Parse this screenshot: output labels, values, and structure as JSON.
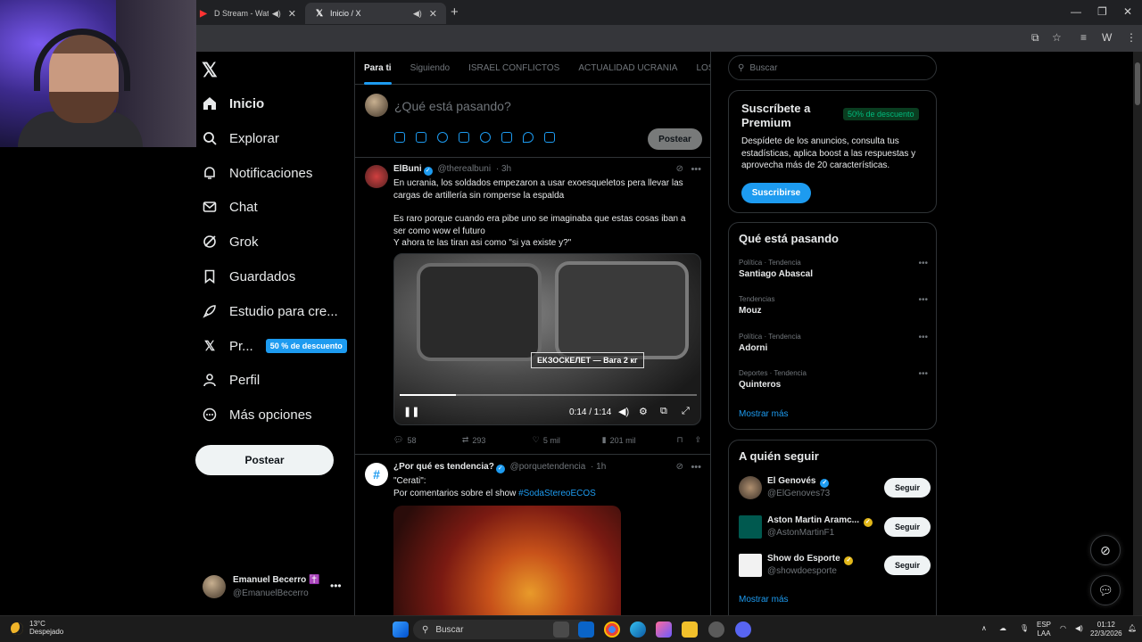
{
  "browser": {
    "tabs": [
      {
        "title": "D Stream - Watch Live o",
        "favicon": "youtube-icon",
        "active": false
      },
      {
        "title": "Inicio / X",
        "favicon": "x-logo-icon",
        "active": true
      }
    ]
  },
  "sidebar": {
    "items": [
      {
        "label": "Inicio",
        "icon": "home-icon",
        "active": true
      },
      {
        "label": "Explorar",
        "icon": "search-icon"
      },
      {
        "label": "Notificaciones",
        "icon": "bell-icon"
      },
      {
        "label": "Chat",
        "icon": "mail-icon"
      },
      {
        "label": "Grok",
        "icon": "grok-icon"
      },
      {
        "label": "Guardados",
        "icon": "bookmark-icon"
      },
      {
        "label": "Estudio para cre...",
        "icon": "rocket-icon"
      },
      {
        "label": "Pr...",
        "icon": "x-logo-icon",
        "badge": "50 % de descuento"
      },
      {
        "label": "Perfil",
        "icon": "person-icon"
      },
      {
        "label": "Más opciones",
        "icon": "more-circle-icon"
      }
    ],
    "post_button": "Postear",
    "profile": {
      "name": "Emanuel Becerro ✝️",
      "handle": "@EmanuelBecerro"
    }
  },
  "feed": {
    "tabs": [
      "Para ti",
      "Siguiendo",
      "ISRAEL CONFLICTOS",
      "ACTUALIDAD UCRANIA",
      "LOS"
    ],
    "compose": {
      "placeholder": "¿Qué está pasando?",
      "post_button": "Postear"
    },
    "tweets": [
      {
        "name": "ElBuni",
        "handle": "@therealbuni",
        "time": "· 3h",
        "paragraphs": [
          "En ucrania, los soldados empezaron a usar exoesqueletos pera llevar las cargas de artillería sin romperse la espalda",
          "Es raro porque cuando era pibe uno se imaginaba que estas cosas iban a ser como wow el futuro\nY ahora te las tiran asi como \"si ya existe y?\""
        ],
        "video": {
          "overlay_text": "ЕКЗОСКЕЛЕТ — Вага 2 кг",
          "time": "0:14 / 1:14",
          "progress": 0.19
        },
        "actions": {
          "replies": "58",
          "reposts": "293",
          "likes": "5 mil",
          "views": "201 mil"
        }
      },
      {
        "name": "¿Por qué es tendencia?",
        "handle": "@porquetendencia",
        "time": "· 1h",
        "paragraphs": [
          "\"Cerati\":\nPor comentarios sobre el show "
        ],
        "hashtag": "#SodaStereoECOS"
      }
    ]
  },
  "right": {
    "search_placeholder": "Buscar",
    "premium": {
      "title": "Suscríbete a Premium",
      "discount": "50% de descuento",
      "description": "Despídete de los anuncios, consulta tus estadísticas, aplica boost a las respuestas y aprovecha más de 20 características.",
      "button": "Suscribirse"
    },
    "trends": {
      "title": "Qué está pasando",
      "items": [
        {
          "context": "Política · Tendencia",
          "name": "Santiago Abascal"
        },
        {
          "context": "Tendencias",
          "name": "Mouz"
        },
        {
          "context": "Política · Tendencia",
          "name": "Adorni"
        },
        {
          "context": "Deportes · Tendencia",
          "name": "Quinteros"
        }
      ],
      "more": "Mostrar más"
    },
    "who_to_follow": {
      "title": "A quién seguir",
      "users": [
        {
          "name": "El Genovés",
          "handle": "@ElGenoves73",
          "verified": "blue",
          "button": "Seguir"
        },
        {
          "name": "Aston Martin Aramc...",
          "handle": "@AstonMartinF1",
          "verified": "gold",
          "button": "Seguir"
        },
        {
          "name": "Show do Esporte",
          "handle": "@showdoesporte",
          "verified": "gold",
          "button": "Seguir"
        }
      ],
      "more": "Mostrar más"
    }
  },
  "taskbar": {
    "weather": {
      "temp": "13°C",
      "condition": "Despejado"
    },
    "search": "Buscar",
    "lang": [
      "ESP",
      "LAA"
    ],
    "time": "01:12",
    "date": "22/3/2026"
  },
  "colors": {
    "accent": "#1d9bf0",
    "background": "#000000",
    "border": "#2f3336",
    "muted": "#71767b"
  }
}
